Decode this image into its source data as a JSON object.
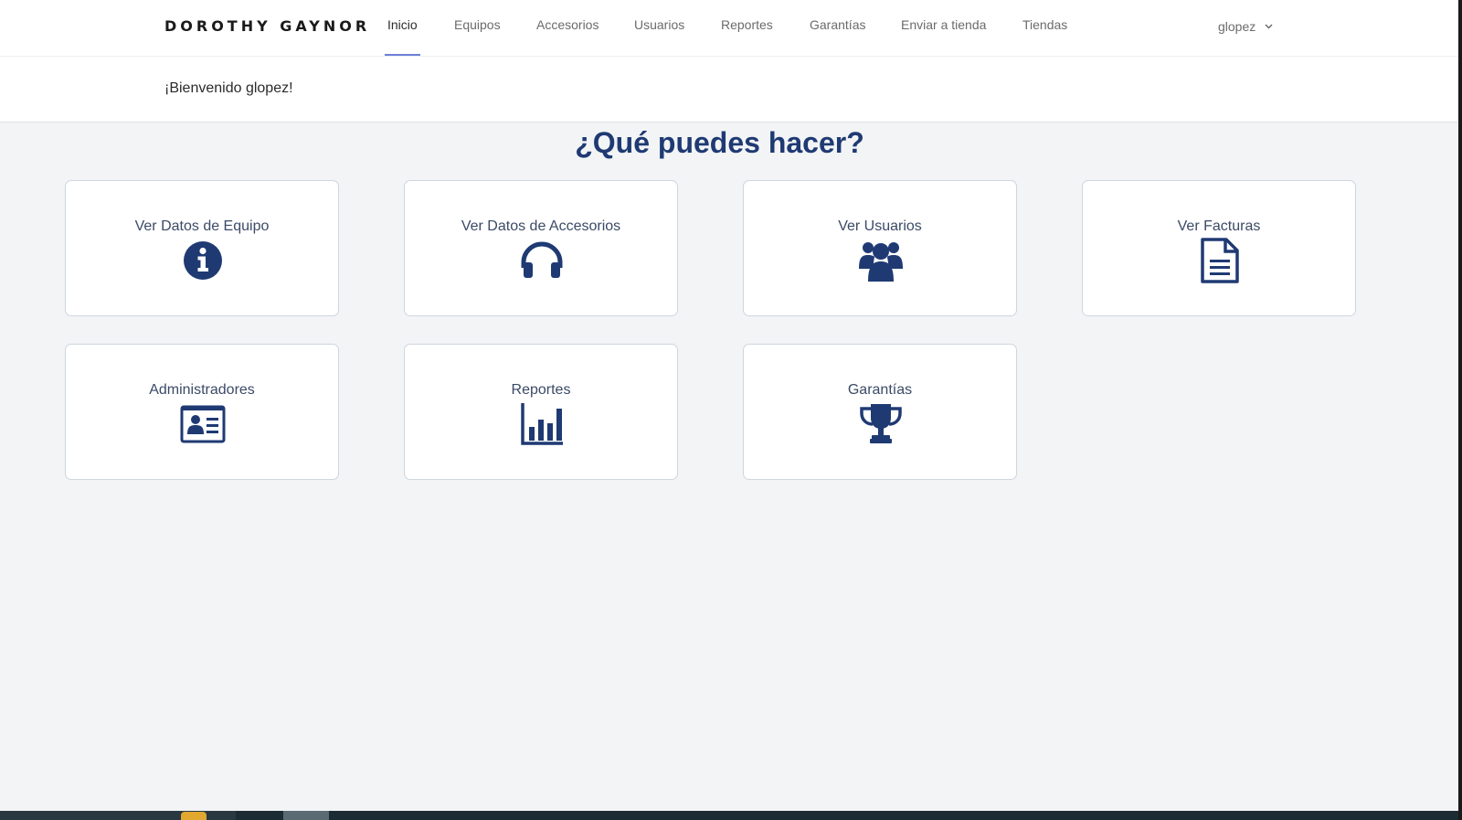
{
  "brand": {
    "name": "DOROTHY GAYNOR"
  },
  "nav": {
    "items": [
      {
        "label": "Inicio",
        "active": true
      },
      {
        "label": "Equipos",
        "active": false
      },
      {
        "label": "Accesorios",
        "active": false
      },
      {
        "label": "Usuarios",
        "active": false
      },
      {
        "label": "Reportes",
        "active": false
      },
      {
        "label": "Garantías",
        "active": false
      },
      {
        "label": "Enviar a tienda",
        "active": false
      },
      {
        "label": "Tiendas",
        "active": false
      }
    ],
    "user": {
      "name": "glopez",
      "icon": "chevron-down-icon"
    }
  },
  "welcome": {
    "text": "¡Bienvenido glopez!"
  },
  "page": {
    "title": "¿Qué puedes hacer?"
  },
  "cards": [
    {
      "label": "Ver Datos de Equipo",
      "icon": "info-circle-icon"
    },
    {
      "label": "Ver Datos de Accesorios",
      "icon": "headphones-icon"
    },
    {
      "label": "Ver Usuarios",
      "icon": "users-icon"
    },
    {
      "label": "Ver Facturas",
      "icon": "document-icon"
    },
    {
      "label": "Administradores",
      "icon": "id-card-icon"
    },
    {
      "label": "Reportes",
      "icon": "bar-chart-icon"
    },
    {
      "label": "Garantías",
      "icon": "trophy-icon"
    }
  ],
  "colors": {
    "primary": "#1f3a73",
    "nav_active_underline": "#6c7fd8",
    "background": "#f2f4f6",
    "card_border": "#cfd6de"
  }
}
